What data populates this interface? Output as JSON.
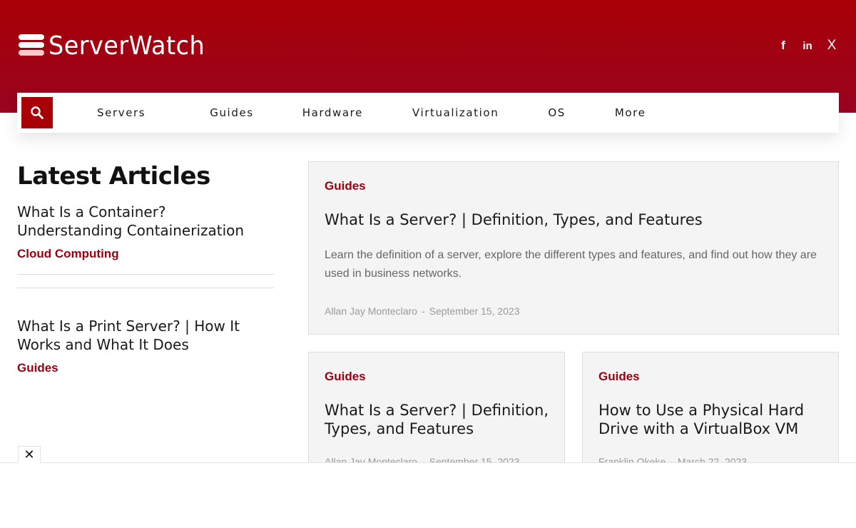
{
  "brand": {
    "name": "ServerWatch",
    "primary_color": "#a80006",
    "category_color": "#9a0010"
  },
  "social": [
    {
      "name": "facebook",
      "glyph": "f"
    },
    {
      "name": "linkedin",
      "glyph": "in"
    },
    {
      "name": "x",
      "glyph": "X"
    }
  ],
  "nav": {
    "search_icon": "search-icon",
    "items": [
      "Servers",
      "Guides",
      "Hardware",
      "Virtualization",
      "OS",
      "More"
    ]
  },
  "sidebar": {
    "title": "Latest Articles",
    "articles": [
      {
        "title": "What Is a Container? Understanding Containerization",
        "category": "Cloud Computing"
      },
      {
        "title": "What Is a Print Server? | How It Works and What It Does",
        "category": "Guides"
      }
    ]
  },
  "featured": {
    "category": "Guides",
    "title": "What Is a Server? | Definition, Types, and Features",
    "description": "Learn the definition of a server, explore the different types and features, and find out how they are used in business networks.",
    "author": "Allan Jay Monteclaro",
    "separator": "-",
    "date": "September 15, 2023"
  },
  "cards": [
    {
      "category": "Guides",
      "title": "What Is a Server? | Definition, Types, and Features",
      "author": "Allan Jay Monteclaro",
      "separator": "-",
      "date": "September 15, 2023"
    },
    {
      "category": "Guides",
      "title": "How to Use a Physical Hard Drive with a VirtualBox VM",
      "author": "Franklin Okeke",
      "separator": "-",
      "date": "March 22, 2023"
    }
  ],
  "ad": {
    "close_glyph": "✕"
  }
}
